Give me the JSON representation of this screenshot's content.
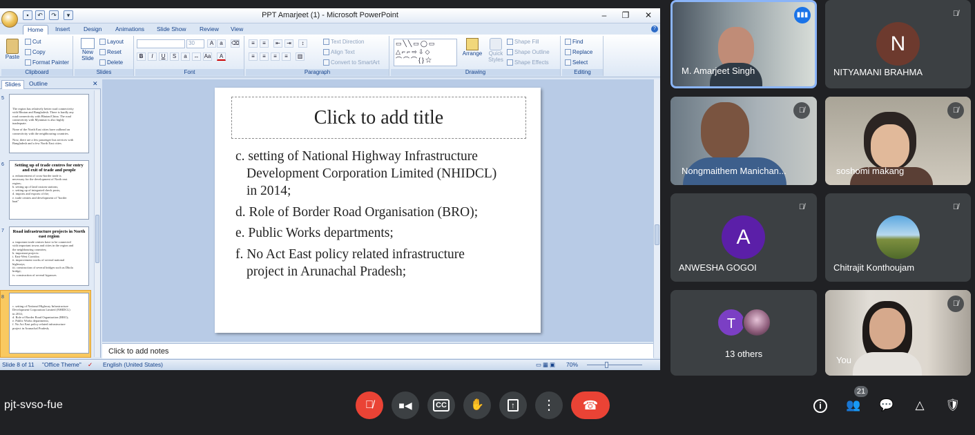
{
  "ppt": {
    "window_title": "PPT Amarjeet (1) - Microsoft PowerPoint",
    "tabs": [
      "Home",
      "Insert",
      "Design",
      "Animations",
      "Slide Show",
      "Review",
      "View"
    ],
    "ribbon": {
      "clipboard": {
        "paste": "Paste",
        "cut": "Cut",
        "copy": "Copy",
        "format_painter": "Format Painter",
        "label": "Clipboard"
      },
      "slides": {
        "new_slide": "New Slide",
        "layout": "Layout",
        "reset": "Reset",
        "delete": "Delete",
        "label": "Slides"
      },
      "font": {
        "size": "30",
        "label": "Font"
      },
      "paragraph": {
        "text_direction": "Text Direction",
        "align_text": "Align Text",
        "convert_smartart": "Convert to SmartArt",
        "label": "Paragraph"
      },
      "drawing": {
        "arrange": "Arrange",
        "quick_styles": "Quick Styles",
        "shape_fill": "Shape Fill",
        "shape_outline": "Shape Outline",
        "shape_effects": "Shape Effects",
        "label": "Drawing"
      },
      "editing": {
        "find": "Find",
        "replace": "Replace",
        "select": "Select",
        "label": "Editing"
      }
    },
    "panel_tabs": {
      "slides": "Slides",
      "outline": "Outline"
    },
    "thumbnails": [
      {
        "num": "5",
        "title": "",
        "lines": [
          "The region has relatively better road connectivity",
          "with Bhutan and Bangladesh. There is hardly any",
          "road connectivity with Bhutan/China. The road",
          "connectivity with Myanmar is also highly",
          "inadequate.",
          "",
          "None of the North East cities have railhead on",
          "connectivity with the neighbouring countries.",
          "",
          "Now, there are a few passenger bus services with",
          "Bangladesh and a few North East cities."
        ]
      },
      {
        "num": "6",
        "title": "Setting up of trade centres for entry and exit of trade and people",
        "lines": [
          "a. enhancement of cross-border trade is",
          "necessary for the development of North east",
          "region;",
          "b. setting up of land custom stations;",
          "c. setting up of integrated check posts;",
          "d. imports and exports of the;",
          "e. trade centres and development of \"border",
          "haat\""
        ]
      },
      {
        "num": "7",
        "title": "Road infrastructure projects in North east region",
        "lines": [
          "a. important trade centres have to be connected",
          "with important towns and cities in the region and",
          "the neighbouring countries;",
          "b. important projects:",
          "i. East-West Corridor;",
          "ii. improvement works of several national",
          "highways;",
          "iii. construction of several bridges such as Dhola",
          "bridge;",
          "iv. construction of several bypasses"
        ]
      },
      {
        "num": "8",
        "title": "",
        "lines": [
          "c. setting of National Highway Infrastructure",
          "Development Corporation Limited (NHIDCL)",
          "in 2014;",
          "d. Role of Border Road Organisation (BRO);",
          "e. Public Works departments;",
          "f. No Act East policy related infrastructure",
          "project in Arunachal Pradesh;"
        ]
      }
    ],
    "slide": {
      "title_placeholder": "Click to add title",
      "body_lines": [
        "c. setting  of National Highway  Infrastructure",
        "Development  Corporation Limited  (NHIDCL)",
        "in 2014;",
        "d. Role of Border Road Organisation  (BRO);",
        "e. Public Works departments;",
        "f.  No Act East policy  related  infrastructure",
        "project in Arunachal Pradesh;"
      ]
    },
    "notes_placeholder": "Click to add notes",
    "status": {
      "slide": "Slide 8 of 11",
      "theme": "\"Office Theme\"",
      "language": "English (United States)",
      "zoom": "70%"
    }
  },
  "meet": {
    "participants": [
      {
        "name": "M. Amarjeet Singh",
        "speaking": true
      },
      {
        "name": "NITYAMANI BRAHMA",
        "initial": "N",
        "color": "#6d3a2e"
      },
      {
        "name": "Nongmaithem Manichan..."
      },
      {
        "name": "soshomi makang"
      },
      {
        "name": "ANWESHA GOGOI",
        "initial": "A",
        "color": "#5b1fa8"
      },
      {
        "name": "Chitrajit Konthoujam"
      },
      {
        "name": "13 others",
        "initial": "T",
        "color": "#7b3fc4"
      },
      {
        "name": "You"
      }
    ],
    "meeting_code": "pjt-svso-fue",
    "people_count": "21",
    "colors": {
      "end_call": "#ea4335",
      "mic_off": "#ea4335",
      "speaking": "#1a73e8"
    }
  }
}
